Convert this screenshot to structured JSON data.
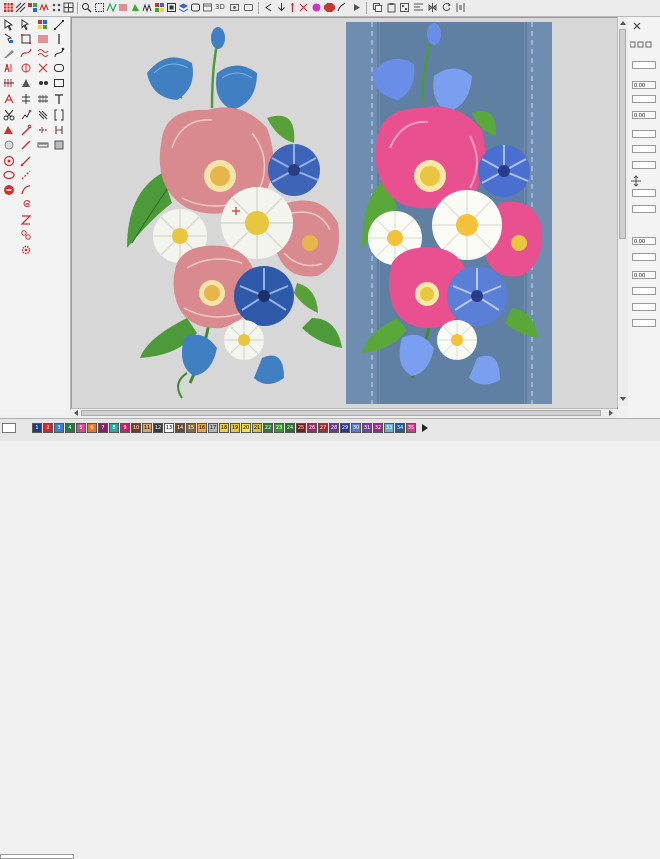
{
  "toolbar": {
    "view_3d_label": "3D"
  },
  "right_panel": {
    "fields": [
      "0.00",
      "0.00",
      "0.00",
      "0.00"
    ]
  },
  "palette": {
    "swatches": [
      {
        "label": "1",
        "color": "#1f3b8a"
      },
      {
        "label": "2",
        "color": "#d2262e"
      },
      {
        "label": "3",
        "color": "#3d7ec9"
      },
      {
        "label": "4",
        "color": "#1f7d41"
      },
      {
        "label": "5",
        "color": "#d24f8c"
      },
      {
        "label": "6",
        "color": "#e57627"
      },
      {
        "label": "7",
        "color": "#8a1f62"
      },
      {
        "label": "8",
        "color": "#2aa8a0"
      },
      {
        "label": "9",
        "color": "#c5226b"
      },
      {
        "label": "10",
        "color": "#7a3a1a"
      },
      {
        "label": "11",
        "color": "#d9a36a"
      },
      {
        "label": "12",
        "color": "#3a3a3a"
      },
      {
        "label": "13",
        "color": "#ffffff"
      },
      {
        "label": "14",
        "color": "#6b4a2a"
      },
      {
        "label": "15",
        "color": "#8a6a3a"
      },
      {
        "label": "16",
        "color": "#f2a640"
      },
      {
        "label": "17",
        "color": "#b7b7b7"
      },
      {
        "label": "18",
        "color": "#f5d23a"
      },
      {
        "label": "19",
        "color": "#e8c640"
      },
      {
        "label": "20",
        "color": "#f8e24a"
      },
      {
        "label": "21",
        "color": "#d6c23a"
      },
      {
        "label": "22",
        "color": "#2f7a30"
      },
      {
        "label": "23",
        "color": "#3a9a2a"
      },
      {
        "label": "24",
        "color": "#2e6b2e"
      },
      {
        "label": "25",
        "color": "#7a1a1a"
      },
      {
        "label": "26",
        "color": "#a02a6a"
      },
      {
        "label": "27",
        "color": "#a82a2a"
      },
      {
        "label": "28",
        "color": "#6a3a8a"
      },
      {
        "label": "29",
        "color": "#2a3a8a"
      },
      {
        "label": "30",
        "color": "#5a7ac2"
      },
      {
        "label": "31",
        "color": "#7a3aa8"
      },
      {
        "label": "32",
        "color": "#9a2a7a"
      },
      {
        "label": "33",
        "color": "#6ab0d8"
      },
      {
        "label": "34",
        "color": "#2a5a9a"
      },
      {
        "label": "35",
        "color": "#d83a8a"
      }
    ]
  },
  "colors": {
    "canvas_bg": "#d7d7d7",
    "denim": "#5f7fa3",
    "pink_flower": "#e8508f",
    "rose_embroidered": "#d98a8e",
    "blue_flower": "#5a7fd6",
    "leaf": "#5aa03a"
  }
}
